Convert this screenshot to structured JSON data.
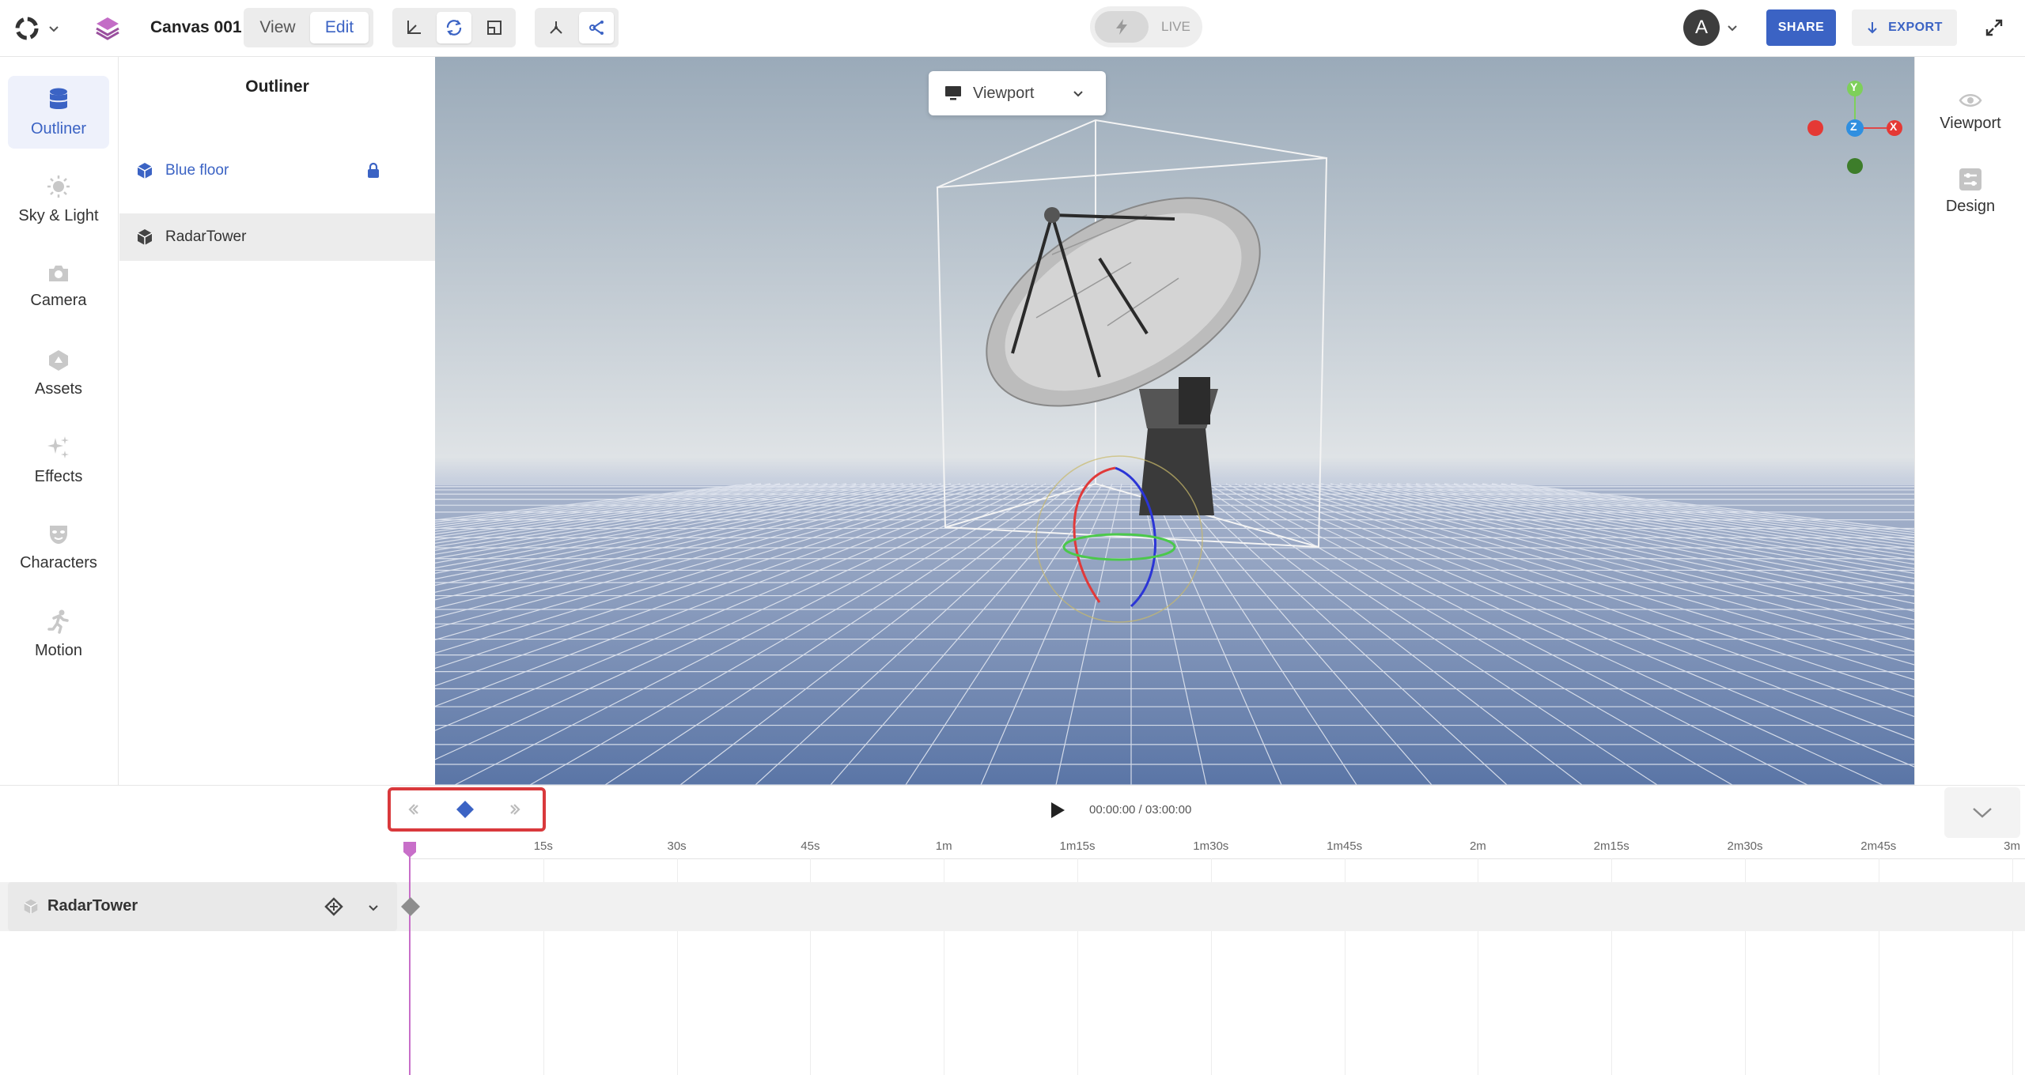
{
  "header": {
    "canvas_title": "Canvas 001",
    "mode_tabs": [
      {
        "label": "View",
        "active": false
      },
      {
        "label": "Edit",
        "active": true
      }
    ],
    "live_label": "LIVE",
    "avatar_initial": "A",
    "share_label": "SHARE",
    "export_label": "EXPORT",
    "accent_color": "#3b63c4"
  },
  "left_rail": {
    "items": [
      {
        "label": "Outliner",
        "icon": "database-icon",
        "active": true
      },
      {
        "label": "Sky & Light",
        "icon": "sun-icon",
        "active": false
      },
      {
        "label": "Camera",
        "icon": "camera-icon",
        "active": false
      },
      {
        "label": "Assets",
        "icon": "assets-icon",
        "active": false
      },
      {
        "label": "Effects",
        "icon": "sparkles-icon",
        "active": false
      },
      {
        "label": "Characters",
        "icon": "mask-icon",
        "active": false
      },
      {
        "label": "Motion",
        "icon": "running-icon",
        "active": false
      }
    ]
  },
  "outliner": {
    "title": "Outliner",
    "items": [
      {
        "name": "Blue floor",
        "icon": "cube-icon",
        "locked": true,
        "color": "#3b63c4"
      },
      {
        "name": "RadarTower",
        "icon": "cube-icon",
        "selected": true
      }
    ]
  },
  "viewport": {
    "selector_label": "Viewport",
    "gizmo_axes": [
      "Y",
      "Z",
      "X"
    ]
  },
  "right_rail": {
    "items": [
      {
        "label": "Viewport",
        "icon": "eye-icon"
      },
      {
        "label": "Design",
        "icon": "sliders-icon"
      }
    ]
  },
  "timeline": {
    "time_display": "00:00:00 / 03:00:00",
    "ticks": [
      "15s",
      "30s",
      "45s",
      "1m",
      "1m15s",
      "1m30s",
      "1m45s",
      "2m",
      "2m15s",
      "2m30s",
      "2m45s",
      "3m"
    ],
    "track_name": "RadarTower",
    "playhead_color": "#c86fc9"
  }
}
